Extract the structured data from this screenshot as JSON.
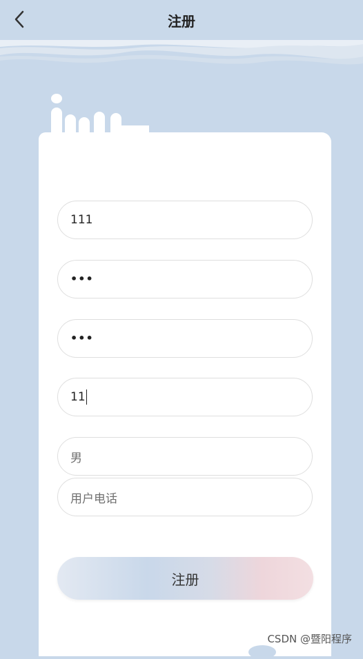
{
  "header": {
    "title": "注册",
    "back_icon": "chevron-left-icon"
  },
  "form": {
    "username": {
      "value": "111"
    },
    "password": {
      "value": "•••"
    },
    "confirm_password": {
      "value": "•••"
    },
    "age": {
      "value": "11"
    },
    "gender": {
      "placeholder": "男"
    },
    "phone": {
      "placeholder": "用户电话"
    }
  },
  "register_button": {
    "label": "注册"
  },
  "watermark": "CSDN @暨阳程序",
  "colors": {
    "background": "#c8d8ea",
    "card": "#ffffff",
    "field_border": "#dedede"
  }
}
